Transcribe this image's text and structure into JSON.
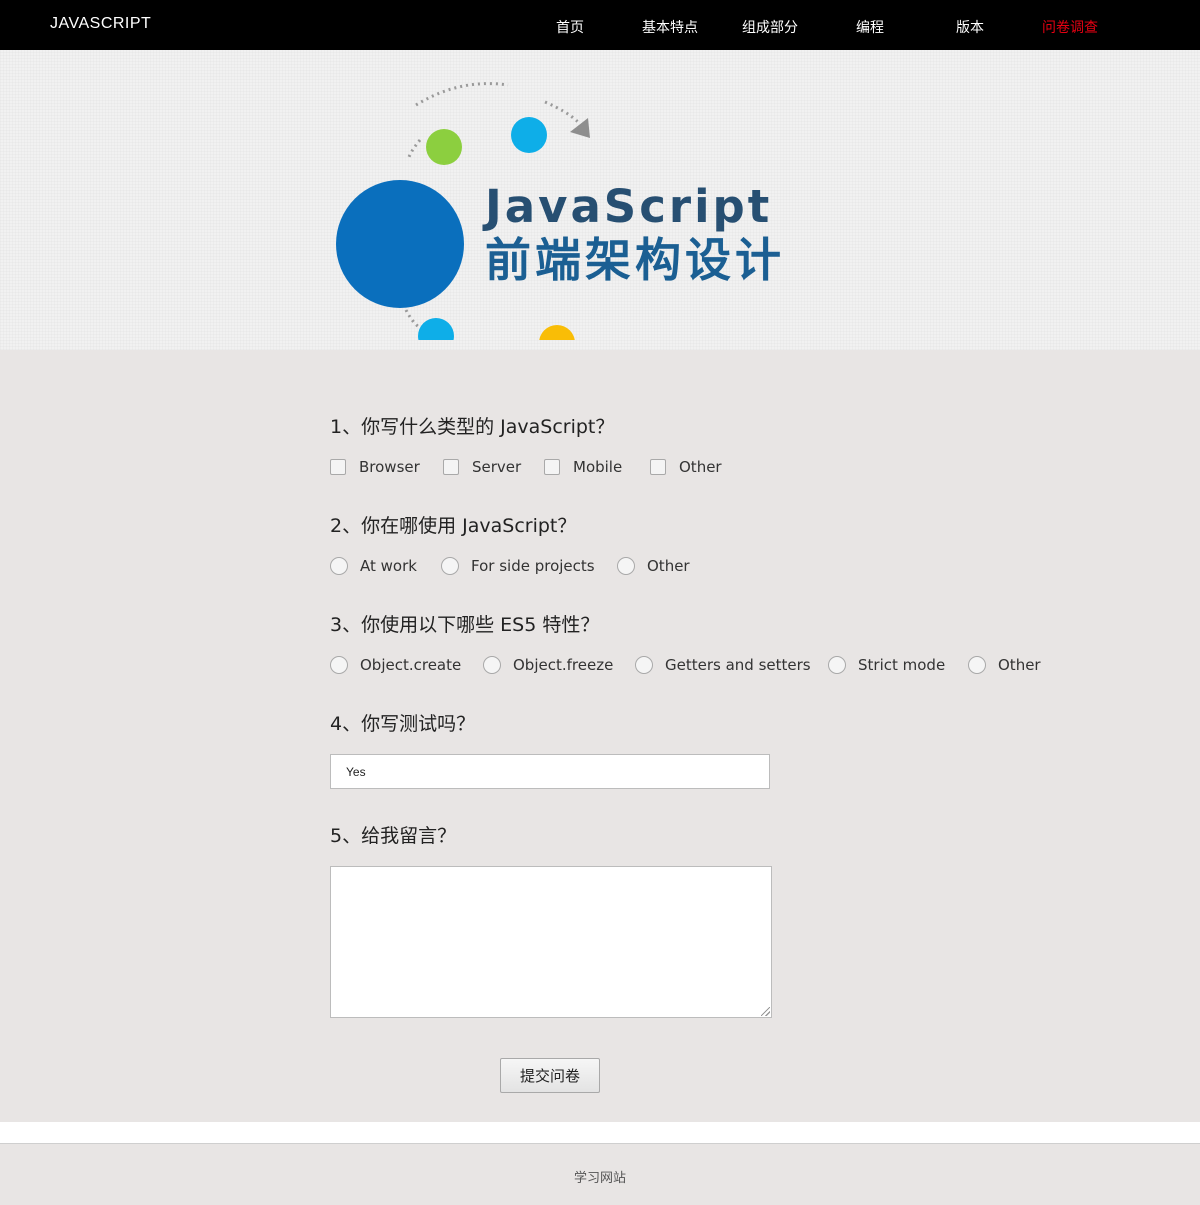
{
  "header": {
    "brand": "JAVASCRIPT",
    "nav": [
      {
        "label": "首页"
      },
      {
        "label": "基本特点"
      },
      {
        "label": "组成部分"
      },
      {
        "label": "编程"
      },
      {
        "label": "版本"
      },
      {
        "label": "问卷调查",
        "active": true
      }
    ]
  },
  "banner": {
    "logo_title": "JavaScript",
    "logo_subtitle": "前端架构设计",
    "colors": {
      "main": "#0a6fbd",
      "green": "#8ccf3f",
      "cyan": "#0eaee8",
      "yellow": "#f9bd06",
      "text": "#1b5f93"
    }
  },
  "survey": {
    "q1": {
      "title": "1、你写什么类型的 JavaScript？",
      "type": "checkbox",
      "options": [
        "Browser",
        "Server",
        "Mobile",
        "Other"
      ]
    },
    "q2": {
      "title": "2、你在哪使用 JavaScript？",
      "type": "radio",
      "options": [
        "At work",
        "For side projects",
        "Other"
      ]
    },
    "q3": {
      "title": "3、你使用以下哪些 ES5 特性？",
      "type": "radio",
      "options": [
        "Object.create",
        "Object.freeze",
        "Getters and setters",
        "Strict mode",
        "Other"
      ]
    },
    "q4": {
      "title": "4、你写测试吗？",
      "value": "Yes"
    },
    "q5": {
      "title": "5、给我留言？",
      "value": ""
    },
    "submit_label": "提交问卷"
  },
  "footer": {
    "text": "学习网站"
  }
}
